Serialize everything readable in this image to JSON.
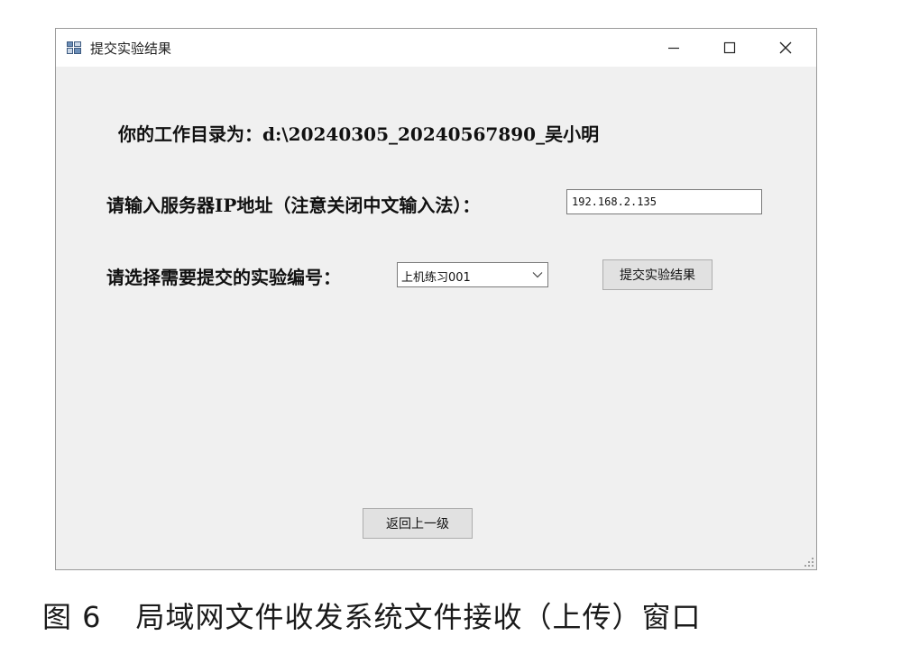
{
  "window": {
    "title": "提交实验结果",
    "icon": "app-window-icon",
    "controls": {
      "minimize": "minimize-icon",
      "maximize": "maximize-icon",
      "close": "close-icon"
    }
  },
  "form": {
    "workdir_label": "你的工作目录为：d:\\20240305_20240567890_吴小明",
    "ip_label": "请输入服务器IP地址（注意关闭中文输入法）：",
    "ip_value": "192.168.2.135",
    "experiment_label": "请选择需要提交的实验编号：",
    "experiment_selected": "上机练习001",
    "submit_button": "提交实验结果",
    "back_button": "返回上一级"
  },
  "caption": {
    "number": "图 6",
    "text": "局域网文件收发系统文件接收（上传）窗口"
  },
  "colors": {
    "window_bg": "#f0f0f0",
    "titlebar_bg": "#ffffff",
    "button_bg": "#e1e1e1",
    "border": "#7a7a7a"
  }
}
